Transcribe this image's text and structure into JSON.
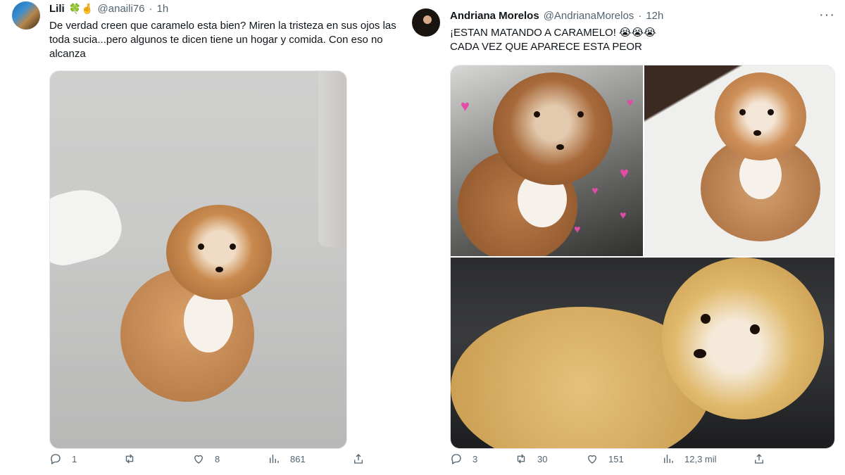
{
  "tweets": [
    {
      "display_name": "Lili",
      "name_emojis": "🍀🤞",
      "handle": "@anaili76",
      "separator": "·",
      "time": "1h",
      "text": "De verdad creen que caramelo esta bien? Miren la tristeza en sus ojos las toda sucia...pero algunos te dicen tiene un hogar y comida. Con eso no alcanza",
      "replies": "1",
      "retweets": "",
      "likes": "8",
      "views": "861"
    },
    {
      "display_name": "Andriana Morelos",
      "handle": "@AndrianaMorelos",
      "separator": "·",
      "time": "12h",
      "more": "···",
      "text_line1": "¡ESTAN MATANDO A CARAMELO! 😭😭😭",
      "text_line2": "CADA VEZ QUE APARECE ESTA PEOR",
      "replies": "3",
      "retweets": "30",
      "likes": "151",
      "views": "12,3 mil"
    }
  ],
  "icons": {
    "reply": "reply-icon",
    "retweet": "retweet-icon",
    "like": "heart-icon",
    "views": "views-icon",
    "share": "share-icon",
    "more": "more-icon"
  },
  "colors": {
    "text": "#0f1419",
    "secondary": "#536471"
  }
}
